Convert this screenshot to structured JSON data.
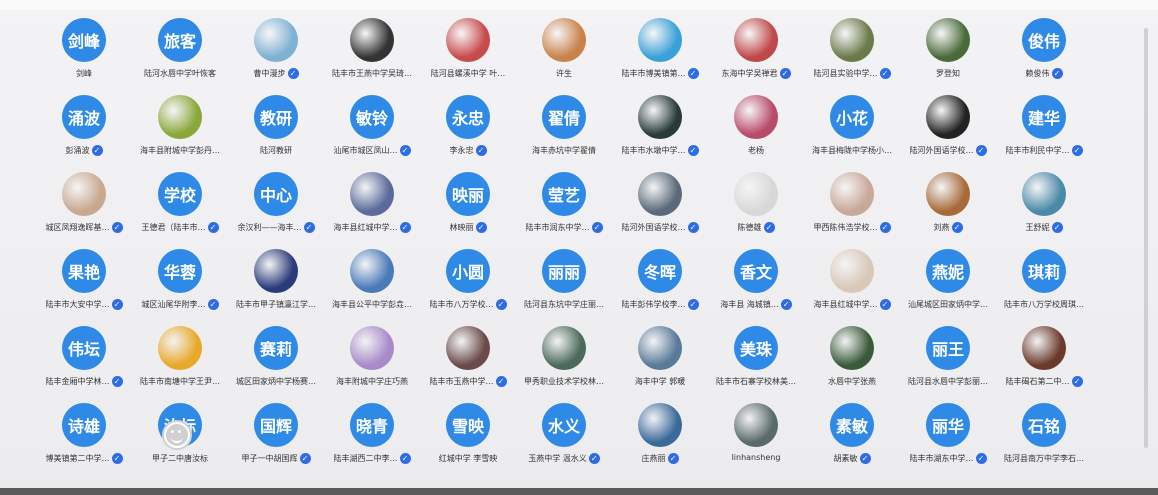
{
  "rows": [
    [
      {
        "avatar_text": "剑峰",
        "name": "剑峰",
        "verified": false,
        "type": "text"
      },
      {
        "avatar_text": "旅客",
        "name": "陆河水唇中学叶恢客",
        "verified": false,
        "type": "text"
      },
      {
        "name": "曹中漫步",
        "verified": true,
        "type": "photo",
        "color": "#7fb1d2"
      },
      {
        "name": "陆丰市王燕中学吴琦…",
        "verified": false,
        "type": "photo",
        "color": "#333"
      },
      {
        "name": "陆河县螺溪中学 叶…",
        "verified": false,
        "type": "photo",
        "color": "#c84b4b"
      },
      {
        "name": "许生",
        "verified": false,
        "type": "photo",
        "color": "#c9824a"
      },
      {
        "name": "陆丰市博美镇第…",
        "verified": true,
        "type": "photo",
        "color": "#3aa0d8"
      },
      {
        "name": "东海中学吴禅君",
        "verified": true,
        "type": "photo",
        "color": "#c04848"
      },
      {
        "name": "陆河县实验中学…",
        "verified": true,
        "type": "photo",
        "color": "#6a7a4a"
      },
      {
        "name": "罗登知",
        "verified": false,
        "type": "photo",
        "color": "#4a6a3a"
      },
      {
        "avatar_text": "俊伟",
        "name": "赖俊伟",
        "verified": true,
        "type": "text"
      }
    ],
    [
      {
        "avatar_text": "涌波",
        "name": "彭涌波",
        "verified": true,
        "type": "text"
      },
      {
        "name": "海丰县附城中学彭丹…",
        "verified": false,
        "type": "photo",
        "color": "#8aa83a"
      },
      {
        "avatar_text": "教研",
        "name": "陆河教研",
        "verified": false,
        "type": "text"
      },
      {
        "avatar_text": "敏铃",
        "name": "汕尾市城区凤山…",
        "verified": true,
        "type": "text"
      },
      {
        "avatar_text": "永忠",
        "name": "李永忠",
        "verified": true,
        "type": "text"
      },
      {
        "avatar_text": "翟倩",
        "name": "海丰赤坑中学翟倩",
        "verified": false,
        "type": "text"
      },
      {
        "name": "陆丰市水墩中学…",
        "verified": true,
        "type": "photo",
        "color": "#2a3a3a"
      },
      {
        "name": "老杨",
        "verified": false,
        "type": "photo",
        "color": "#b84a6a"
      },
      {
        "avatar_text": "小花",
        "name": "海丰县梅陇中学杨小…",
        "verified": false,
        "type": "text"
      },
      {
        "name": "陆河外国语学校…",
        "verified": true,
        "type": "photo",
        "color": "#222"
      },
      {
        "avatar_text": "建华",
        "name": "陆丰市利民中学…",
        "verified": true,
        "type": "text"
      }
    ],
    [
      {
        "name": "城区凤翔逸晖基…",
        "verified": true,
        "type": "photo",
        "color": "#c8a890"
      },
      {
        "avatar_text": "学校",
        "name": "王德君（陆丰市…",
        "verified": true,
        "type": "text"
      },
      {
        "avatar_text": "中心",
        "name": "余汉利——海丰…",
        "verified": true,
        "type": "text"
      },
      {
        "name": "海丰县红城中学…",
        "verified": true,
        "type": "photo",
        "color": "#5a6a9a"
      },
      {
        "avatar_text": "映丽",
        "name": "林映丽",
        "verified": true,
        "type": "text"
      },
      {
        "avatar_text": "莹艺",
        "name": "陆丰市润东中学…",
        "verified": true,
        "type": "text"
      },
      {
        "name": "陆河外国语学校…",
        "verified": true,
        "type": "photo",
        "color": "#5a6a7a"
      },
      {
        "name": "陈德雄",
        "verified": true,
        "type": "photo",
        "color": "#d8d8d8"
      },
      {
        "name": "甲西陈伟浩学校…",
        "verified": true,
        "type": "photo",
        "color": "#c8a898"
      },
      {
        "name": "刘燕",
        "verified": true,
        "type": "photo",
        "color": "#a86a3a"
      },
      {
        "name": "王舒妮",
        "verified": true,
        "type": "photo",
        "color": "#4a8aa8"
      }
    ],
    [
      {
        "avatar_text": "果艳",
        "name": "陆丰市大安中学…",
        "verified": true,
        "type": "text"
      },
      {
        "avatar_text": "华蓉",
        "name": "城区汕尾华附李…",
        "verified": true,
        "type": "text"
      },
      {
        "name": "陆丰市甲子镇瀛江学…",
        "verified": false,
        "type": "photo",
        "color": "#2a3a7a"
      },
      {
        "name": "海丰县公平中学彭垚…",
        "verified": false,
        "type": "photo",
        "color": "#4a7ab8"
      },
      {
        "avatar_text": "小圆",
        "name": "陆丰市八万学校…",
        "verified": true,
        "type": "text"
      },
      {
        "avatar_text": "丽丽",
        "name": "陆河县东坑中学庄丽…",
        "verified": false,
        "type": "text"
      },
      {
        "avatar_text": "冬晖",
        "name": "陆丰彭伟学校李…",
        "verified": true,
        "type": "text"
      },
      {
        "avatar_text": "香文",
        "name": "海丰县 海城镇…",
        "verified": true,
        "type": "text"
      },
      {
        "name": "海丰县红城中学…",
        "verified": true,
        "type": "photo",
        "color": "#d8c8b8"
      },
      {
        "avatar_text": "燕妮",
        "name": "汕尾城区田家炳中学…",
        "verified": false,
        "type": "text"
      },
      {
        "avatar_text": "琪莉",
        "name": "陆丰市八万学校周琪…",
        "verified": false,
        "type": "text"
      }
    ],
    [
      {
        "avatar_text": "伟坛",
        "name": "陆丰金厢中学林…",
        "verified": true,
        "type": "text"
      },
      {
        "name": "陆丰市南塘中学王尹…",
        "verified": false,
        "type": "photo",
        "color": "#e8a82a"
      },
      {
        "avatar_text": "赛莉",
        "name": "城区田家炳中学杨赛…",
        "verified": false,
        "type": "text"
      },
      {
        "name": "海丰附城中学庄巧燕",
        "verified": false,
        "type": "photo",
        "color": "#a88ac8"
      },
      {
        "name": "陆丰市玉燕中学…",
        "verified": true,
        "type": "photo",
        "color": "#6a4a4a"
      },
      {
        "name": "甲秀职业技术学校林…",
        "verified": false,
        "type": "photo",
        "color": "#4a6a5a"
      },
      {
        "name": "海丰中学 郭暖",
        "verified": false,
        "type": "photo",
        "color": "#5a7a9a"
      },
      {
        "avatar_text": "美珠",
        "name": "陆丰市石寨学校林美…",
        "verified": false,
        "type": "text"
      },
      {
        "name": "水唇中学张燕",
        "verified": false,
        "type": "photo",
        "color": "#3a5a3a"
      },
      {
        "avatar_text": "丽王",
        "name": "陆河县水唇中学彭丽…",
        "verified": false,
        "type": "text"
      },
      {
        "name": "陆丰碣石第二中…",
        "verified": true,
        "type": "photo",
        "color": "#6a3a2a"
      }
    ],
    [
      {
        "avatar_text": "诗雄",
        "name": "博美镇第二中学…",
        "verified": true,
        "type": "text"
      },
      {
        "avatar_text": "汝标",
        "name": "甲子二中唐汝标",
        "verified": false,
        "type": "text"
      },
      {
        "avatar_text": "国辉",
        "name": "甲子一中胡国辉",
        "verified": true,
        "type": "text"
      },
      {
        "avatar_text": "晓青",
        "name": "陆丰湖西二中李…",
        "verified": true,
        "type": "text"
      },
      {
        "avatar_text": "雪映",
        "name": "红城中学 李雪映",
        "verified": false,
        "type": "text"
      },
      {
        "avatar_text": "水义",
        "name": "玉燕中学 温水义",
        "verified": true,
        "type": "text"
      },
      {
        "name": "庄燕丽",
        "verified": true,
        "type": "photo",
        "color": "#3a6a9a"
      },
      {
        "name": "linhansheng",
        "verified": false,
        "type": "photo",
        "color": "#5a6a6a"
      },
      {
        "avatar_text": "素敏",
        "name": "胡素敏",
        "verified": true,
        "type": "text"
      },
      {
        "avatar_text": "丽华",
        "name": "陆丰市湖东中学…",
        "verified": true,
        "type": "text"
      },
      {
        "avatar_text": "石铭",
        "name": "陆河县南万中学李石…",
        "verified": false,
        "type": "text"
      }
    ]
  ]
}
